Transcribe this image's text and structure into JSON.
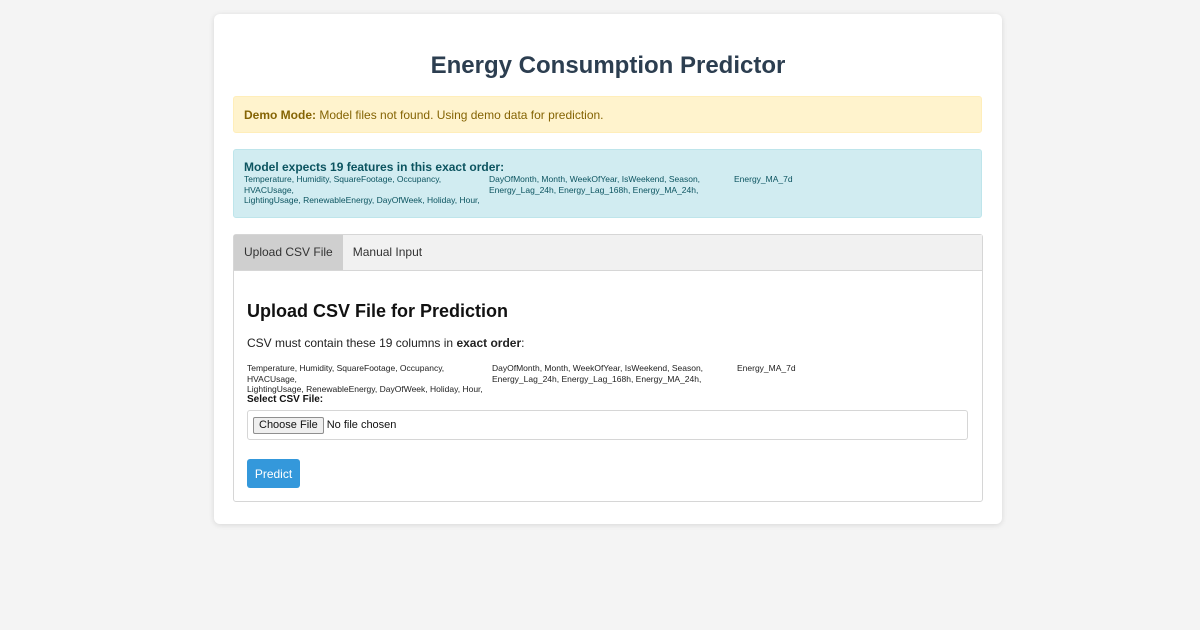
{
  "page": {
    "title": "Energy Consumption Predictor"
  },
  "demo_alert": {
    "label": "Demo Mode:",
    "message": " Model files not found. Using demo data for prediction."
  },
  "info_alert": {
    "title": "Model expects 19 features in this exact order:",
    "columns": [
      [
        "Temperature, Humidity, SquareFootage, Occupancy, HVACUsage,",
        "LightingUsage, RenewableEnergy, DayOfWeek, Holiday, Hour,"
      ],
      [
        "DayOfMonth, Month, WeekOfYear, IsWeekend, Season,",
        "Energy_Lag_24h, Energy_Lag_168h, Energy_MA_24h,"
      ],
      [
        "Energy_MA_7d",
        ""
      ]
    ]
  },
  "tabs": [
    {
      "label": "Upload CSV File",
      "active": true
    },
    {
      "label": "Manual Input",
      "active": false
    }
  ],
  "upload": {
    "heading": "Upload CSV File for Prediction",
    "instr_prefix": "CSV must contain these 19 columns in ",
    "instr_bold": "exact order",
    "instr_suffix": ":",
    "columns": [
      [
        "Temperature, Humidity, SquareFootage, Occupancy, HVACUsage,",
        "LightingUsage, RenewableEnergy, DayOfWeek, Holiday, Hour,"
      ],
      [
        "DayOfMonth, Month, WeekOfYear, IsWeekend, Season,",
        "Energy_Lag_24h, Energy_Lag_168h, Energy_MA_24h,"
      ],
      [
        "Energy_MA_7d",
        ""
      ]
    ],
    "file_label": "Select CSV File:",
    "choose_button": "Choose File",
    "no_file_text": "No file chosen",
    "predict_button": "Predict"
  },
  "colors": {
    "accent": "#3498db",
    "title": "#2c3e50",
    "warning_bg": "#fff3cd",
    "info_bg": "#d1ecf1"
  }
}
